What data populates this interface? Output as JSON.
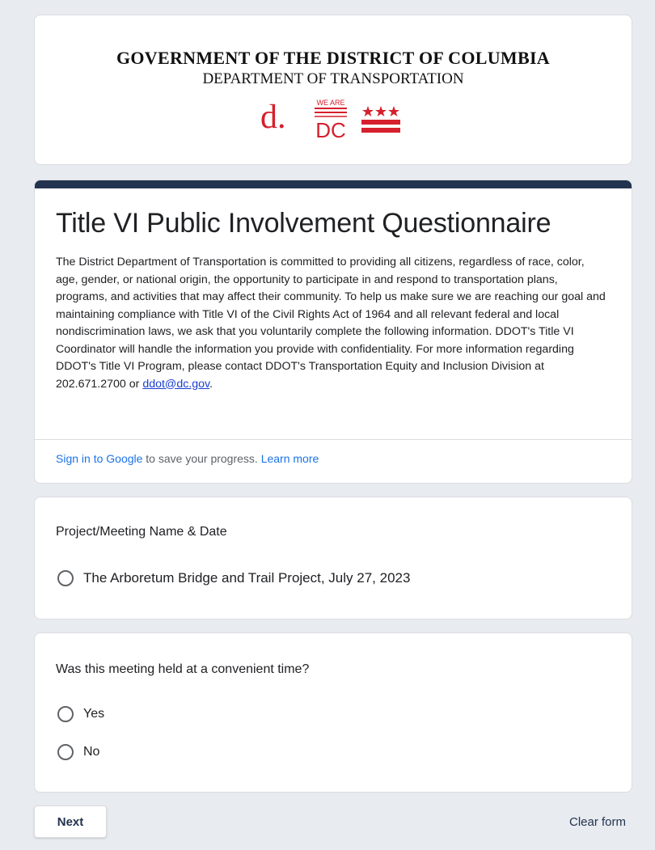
{
  "header": {
    "government": "GOVERNMENT OF THE DISTRICT OF COLUMBIA",
    "department": "DEPARTMENT OF TRANSPORTATION",
    "logo_letter": "d.",
    "logo_we_are": "WE ARE",
    "logo_dc": "DC"
  },
  "form": {
    "title": "Title VI Public Involvement Questionnaire",
    "description": "The District Department of Transportation is committed to providing all citizens, regardless of race, color, age, gender, or national origin, the opportunity to participate in and respond to transportation plans, programs, and activities that may affect their community. To help us make sure we are reaching our goal and maintaining compliance with Title VI of the Civil Rights Act of 1964 and all relevant federal and local nondiscrimination laws, we ask that you voluntarily complete the following information. DDOT's Title VI Coordinator will handle the information you provide with confidentiality. For more information regarding DDOT's Title VI Program, please contact DDOT's Transportation Equity and Inclusion Division at 202.671.2700 or",
    "email": "ddot@dc.gov",
    "email_suffix": ".",
    "signin_link": "Sign in to Google",
    "signin_text": " to save your progress. ",
    "learn_more": "Learn more"
  },
  "questions": [
    {
      "label": "Project/Meeting Name & Date",
      "options": [
        "The Arboretum Bridge and Trail Project, July 27, 2023"
      ]
    },
    {
      "label": "Was this meeting held at a convenient time?",
      "options": [
        "Yes",
        "No"
      ]
    }
  ],
  "footer": {
    "next": "Next",
    "clear": "Clear form"
  },
  "colors": {
    "accent": "#22334f",
    "dc_red": "#d6202d",
    "link": "#1a73e8"
  }
}
